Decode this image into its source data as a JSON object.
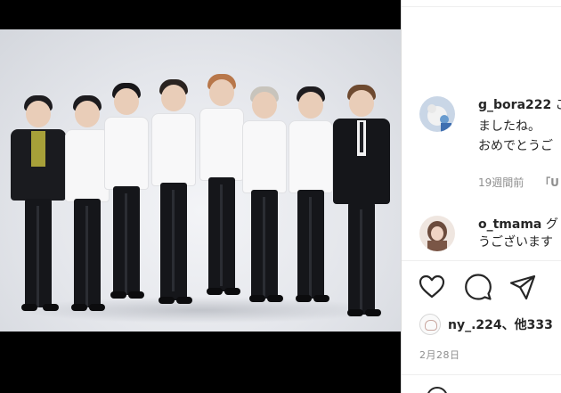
{
  "comments": [
    {
      "username": "g_bora222",
      "text_line1": "ご",
      "text_line2": "ましたね。",
      "text_line3": "おめでとうご",
      "time": "19週間前",
      "reply_label": "「U"
    },
    {
      "username": "o_tmama",
      "text_line1": "グ",
      "text_line2": "うございます"
    }
  ],
  "actions": {
    "like": "heart-icon",
    "comment": "comment-bubble-icon",
    "share": "paper-plane-icon"
  },
  "likes": {
    "text": "ny_.224、他333"
  },
  "post_date": "2月28日",
  "colors": {
    "text": "#262626",
    "muted": "#8e8e8e",
    "divider": "#efefef",
    "backdrop": "#000000"
  }
}
